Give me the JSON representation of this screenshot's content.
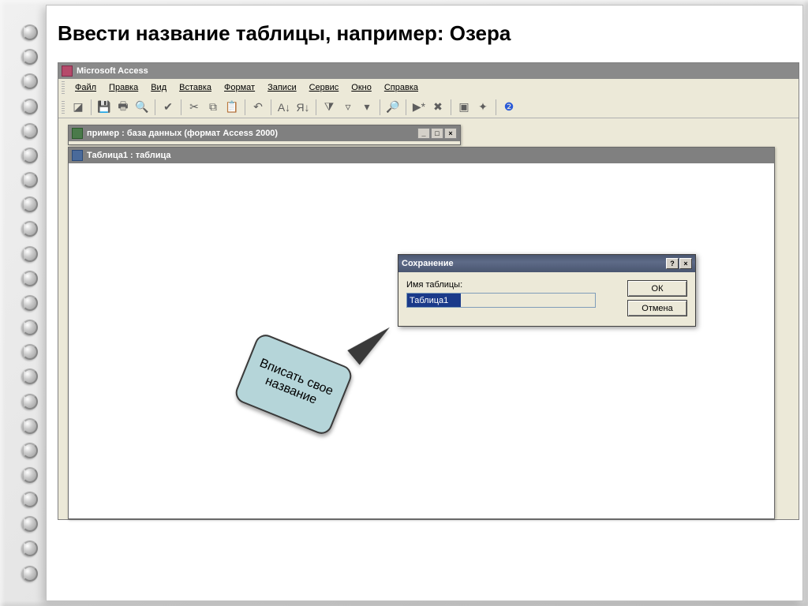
{
  "heading": "Ввести название таблицы, например: Озера",
  "app": {
    "title": "Microsoft Access"
  },
  "menus": {
    "file": "Файл",
    "edit": "Правка",
    "view": "Вид",
    "insert": "Вставка",
    "format": "Формат",
    "records": "Записи",
    "tools": "Сервис",
    "window": "Окно",
    "help": "Справка"
  },
  "db_window": {
    "title": "пример : база данных (формат Access 2000)"
  },
  "table_window": {
    "title": "Таблица1 : таблица"
  },
  "save_dialog": {
    "title": "Сохранение",
    "label": "Имя таблицы:",
    "value": "Таблица1",
    "ok": "ОК",
    "cancel": "Отмена"
  },
  "callout": {
    "text": "Вписать свое название"
  },
  "icons": {
    "minimize": "_",
    "maximize": "□",
    "close": "×",
    "help": "?"
  }
}
